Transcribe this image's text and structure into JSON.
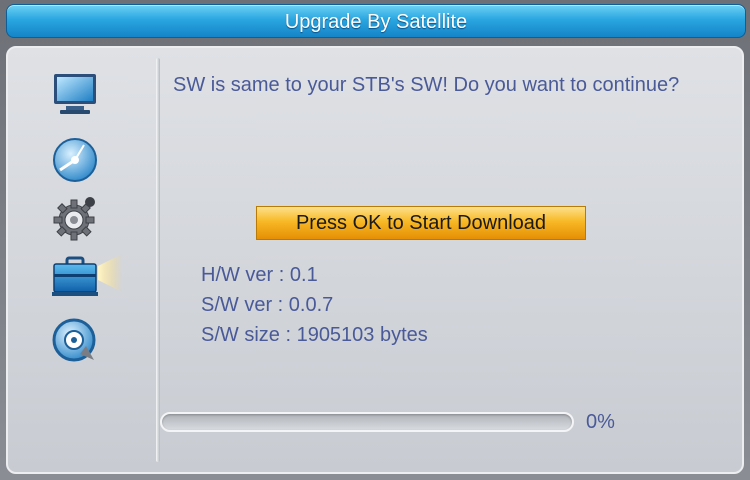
{
  "header": {
    "title": "Upgrade By Satellite"
  },
  "sidebar": {
    "items": [
      {
        "icon": "tv-icon",
        "selected": false
      },
      {
        "icon": "satellite-dish-icon",
        "selected": false
      },
      {
        "icon": "gear-icon",
        "selected": false
      },
      {
        "icon": "toolbox-icon",
        "selected": true
      },
      {
        "icon": "media-player-icon",
        "selected": false
      }
    ]
  },
  "main": {
    "message": "SW is same to your STB's SW! Do you want to continue?",
    "start_button_label": "Press OK to Start Download",
    "hw_version": "H/W ver : 0.1",
    "sw_version": "S/W ver : 0.0.7",
    "sw_size": "S/W size : 1905103 bytes",
    "progress_label": "0%",
    "progress_value": 0
  },
  "colors": {
    "title_bar": "#2aa6e0",
    "text": "#4a5a98",
    "button": "#f8b825"
  }
}
